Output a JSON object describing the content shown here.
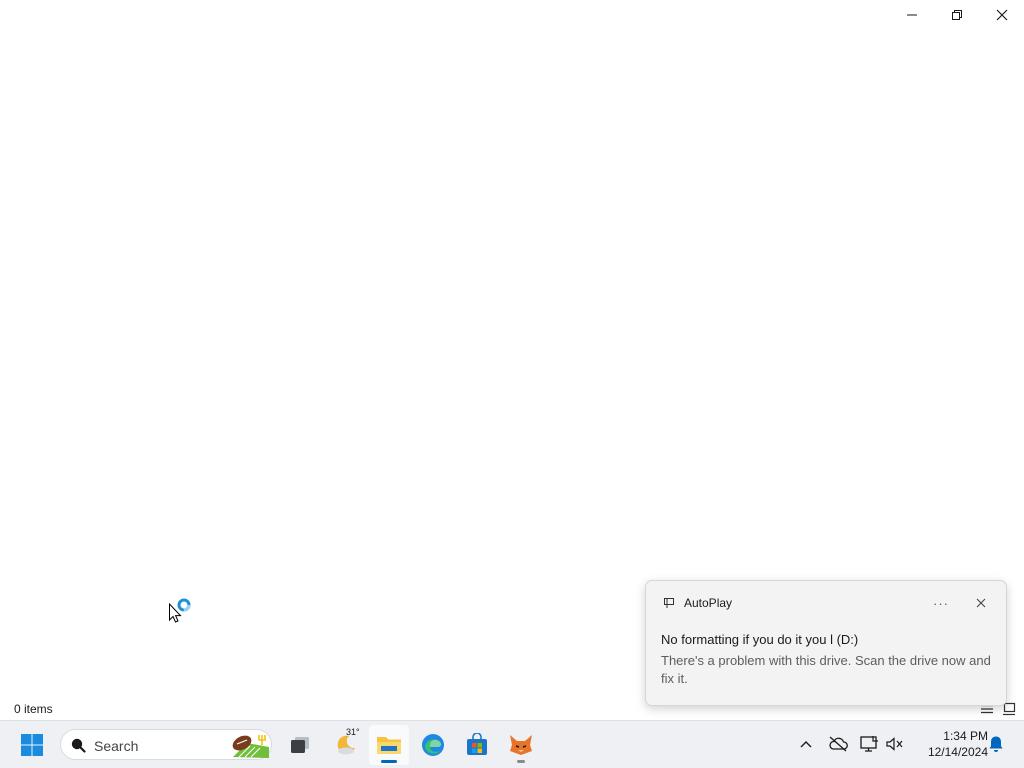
{
  "window": {
    "caption": {
      "minimize_icon": "minimize-icon",
      "restore_icon": "restore-icon",
      "close_icon": "close-icon"
    }
  },
  "status_bar": {
    "item_count": "0 items",
    "view_details_icon": "details-view-icon",
    "view_tiles_icon": "large-icons-view-icon"
  },
  "cursor": {
    "state": "working-in-background"
  },
  "toast": {
    "app_icon": "autoplay-icon",
    "app_name": "AutoPlay",
    "more_label": "···",
    "title": "No formatting if you do it you l (D:)",
    "body": "There's a problem with this drive.  Scan the drive now and fix it."
  },
  "taskbar": {
    "start_icon": "windows-start-icon",
    "search": {
      "placeholder": "Search",
      "icon": "search-icon",
      "art": "football-field-art"
    },
    "apps": [
      {
        "name": "task-view",
        "icon": "task-view-icon"
      },
      {
        "name": "weather",
        "icon": "weather-moon-icon",
        "temp": "31°"
      },
      {
        "name": "file-explorer",
        "icon": "file-explorer-icon",
        "active": true
      },
      {
        "name": "edge",
        "icon": "edge-icon"
      },
      {
        "name": "store",
        "icon": "store-icon"
      },
      {
        "name": "fox-app",
        "icon": "fox-icon",
        "running": true
      }
    ],
    "tray": {
      "chevron_icon": "chevron-up-icon",
      "cloud_icon": "onedrive-cloud-off-icon",
      "network_icon": "network-monitor-icon",
      "volume_icon": "volume-muted-icon",
      "time": "1:34 PM",
      "date": "12/14/2024",
      "notification_icon": "notification-bell-icon"
    }
  },
  "colors": {
    "accent": "#0067c0",
    "taskbar_bg": "#eef0f4",
    "toast_bg": "#f3f3f3"
  }
}
